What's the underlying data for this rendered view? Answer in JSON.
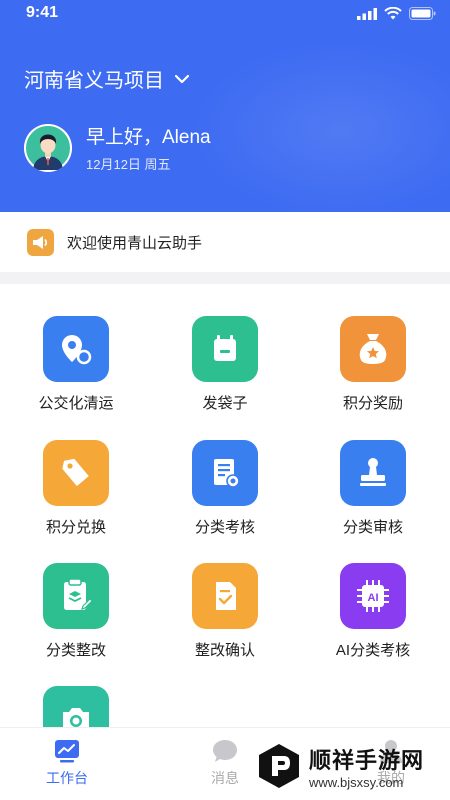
{
  "status_bar": {
    "time": "9:41"
  },
  "header": {
    "project_name": "河南省义马项目",
    "greeting": "早上好，Alena",
    "date": "12月12日 周五"
  },
  "notice": {
    "text": "欢迎使用青山云助手"
  },
  "grid": [
    {
      "label": "公交化清运",
      "icon": "location-pin-icon",
      "color": "#3a7ff0"
    },
    {
      "label": "发袋子",
      "icon": "bag-icon",
      "color": "#2dbf8f"
    },
    {
      "label": "积分奖励",
      "icon": "money-bag-icon",
      "color": "#f0933a"
    },
    {
      "label": "积分兑换",
      "icon": "tag-icon",
      "color": "#f5a837"
    },
    {
      "label": "分类考核",
      "icon": "certificate-icon",
      "color": "#3a7ff0"
    },
    {
      "label": "分类审核",
      "icon": "stamp-icon",
      "color": "#3a7ff0"
    },
    {
      "label": "分类整改",
      "icon": "clipboard-edit-icon",
      "color": "#2dbf8f"
    },
    {
      "label": "整改确认",
      "icon": "document-check-icon",
      "color": "#f5a837"
    },
    {
      "label": "AI分类考核",
      "icon": "ai-chip-icon",
      "color": "#8a3cf0",
      "badge": "AI"
    },
    {
      "label": "",
      "icon": "camera-icon",
      "color": "#2dbf9f"
    }
  ],
  "tabbar": {
    "tabs": [
      {
        "label": "工作台",
        "active": true
      },
      {
        "label": "消息",
        "active": false
      },
      {
        "label": "我的",
        "active": false
      }
    ],
    "active_color": "#3d6bf2",
    "inactive_color": "#aaaaaa"
  },
  "watermark": {
    "title": "顺祥手游网",
    "url": "www.bjsxsy.com"
  }
}
